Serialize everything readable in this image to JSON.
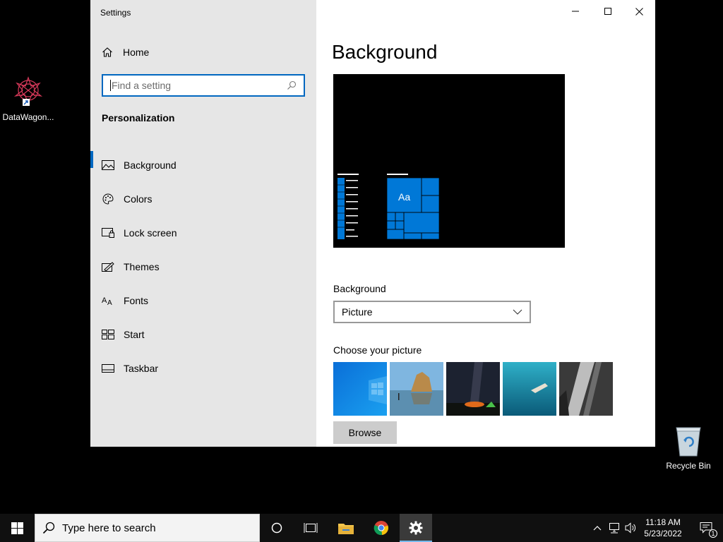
{
  "desktop": {
    "icons": [
      {
        "label": "DataWagon..."
      },
      {
        "label": "Recycle Bin"
      }
    ]
  },
  "window": {
    "title": "Settings",
    "sidebar": {
      "home_label": "Home",
      "search_placeholder": "Find a setting",
      "section_title": "Personalization",
      "items": [
        {
          "label": "Background",
          "icon": "picture-icon",
          "active": true
        },
        {
          "label": "Colors",
          "icon": "palette-icon"
        },
        {
          "label": "Lock screen",
          "icon": "lock-screen-icon"
        },
        {
          "label": "Themes",
          "icon": "themes-icon"
        },
        {
          "label": "Fonts",
          "icon": "fonts-icon"
        },
        {
          "label": "Start",
          "icon": "start-icon"
        },
        {
          "label": "Taskbar",
          "icon": "taskbar-icon"
        }
      ]
    },
    "main": {
      "title": "Background",
      "preview_tile_text": "Aa",
      "background_label": "Background",
      "background_value": "Picture",
      "choose_picture_label": "Choose your picture",
      "browse_label": "Browse"
    }
  },
  "taskbar": {
    "search_placeholder": "Type here to search",
    "time": "11:18 AM",
    "date": "5/23/2022",
    "notification_count": "1"
  },
  "colors": {
    "accent": "#0078d7",
    "sidebar_bg": "#e6e6e6",
    "taskbar_bg": "#101010"
  }
}
